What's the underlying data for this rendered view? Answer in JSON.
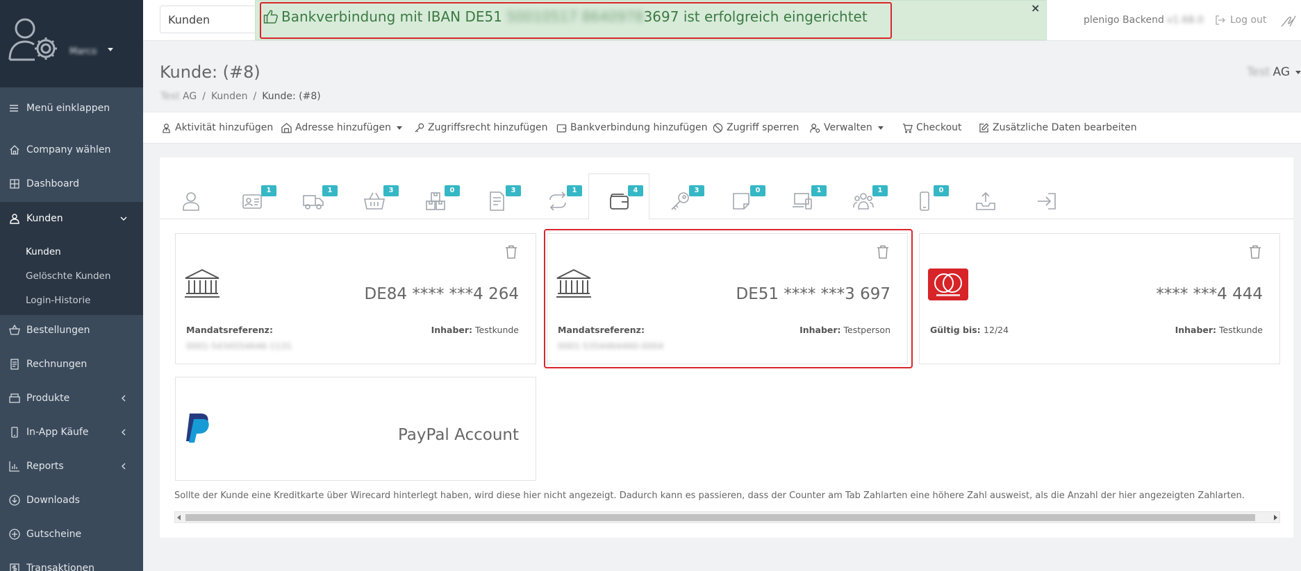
{
  "sidebar": {
    "username": "Marco",
    "items": [
      {
        "label": "Menü einklappen",
        "icon": "menu-icon"
      },
      {
        "label": "Company wählen",
        "icon": "home-icon"
      },
      {
        "label": "Dashboard",
        "icon": "grid-icon"
      },
      {
        "label": "Kunden",
        "icon": "user-icon"
      },
      {
        "label": "Bestellungen",
        "icon": "basket-icon"
      },
      {
        "label": "Rechnungen",
        "icon": "invoice-icon"
      },
      {
        "label": "Produkte",
        "icon": "box-icon"
      },
      {
        "label": "In-App Käufe",
        "icon": "phone-icon"
      },
      {
        "label": "Reports",
        "icon": "chart-icon"
      },
      {
        "label": "Downloads",
        "icon": "download-icon"
      },
      {
        "label": "Gutscheine",
        "icon": "voucher-icon"
      },
      {
        "label": "Transaktionen",
        "icon": "dollar-icon"
      }
    ],
    "subitems": [
      {
        "label": "Kunden"
      },
      {
        "label": "Gelöschte Kunden"
      },
      {
        "label": "Login-Historie"
      }
    ]
  },
  "header": {
    "select_value": "Kunden",
    "alert": {
      "prefix": "Bankverbindung mit IBAN DE51",
      "masked": "50010517 8640978",
      "suffix": "3697 ist erfolgreich eingerichtet",
      "close": "×"
    },
    "backend_label": "plenigo Backend",
    "backend_version": "v1.68.0",
    "logout_label": "Log out"
  },
  "page": {
    "title": "Kunde: (#8)",
    "breadcrumb": [
      {
        "blur": "Test",
        "label": "AG"
      },
      {
        "label": "Kunden"
      },
      {
        "label": "Kunde: (#8)"
      }
    ],
    "company_blur": "Test",
    "company_label": "AG"
  },
  "actions": [
    {
      "label": "Aktivität hinzufügen",
      "icon": "activity-icon"
    },
    {
      "label": "Adresse hinzufügen",
      "icon": "address-icon",
      "dropdown": true
    },
    {
      "label": "Zugriffsrecht hinzufügen",
      "icon": "key-icon"
    },
    {
      "label": "Bankverbindung hinzufügen",
      "icon": "wallet-icon"
    },
    {
      "label": "Zugriff sperren",
      "icon": "ban-icon"
    },
    {
      "label": "Verwalten",
      "icon": "manage-icon",
      "dropdown": true
    },
    {
      "label": "Checkout",
      "icon": "cart-icon"
    },
    {
      "label": "Zusätzliche Daten bearbeiten",
      "icon": "edit-icon"
    }
  ],
  "tabs": [
    {
      "icon": "user-tab-icon",
      "badge": ""
    },
    {
      "icon": "id-card-tab-icon",
      "badge": "1"
    },
    {
      "icon": "truck-tab-icon",
      "badge": "1"
    },
    {
      "icon": "basket-tab-icon",
      "badge": "3"
    },
    {
      "icon": "boxes-tab-icon",
      "badge": "0"
    },
    {
      "icon": "document-tab-icon",
      "badge": "3"
    },
    {
      "icon": "subscription-tab-icon",
      "badge": "1"
    },
    {
      "icon": "wallet-tab-icon",
      "badge": "4",
      "active": true
    },
    {
      "icon": "key-tab-icon",
      "badge": "3"
    },
    {
      "icon": "note-tab-icon",
      "badge": "0"
    },
    {
      "icon": "devices-tab-icon",
      "badge": "1"
    },
    {
      "icon": "group-tab-icon",
      "badge": "1"
    },
    {
      "icon": "mobile-tab-icon",
      "badge": "0"
    },
    {
      "icon": "upload-tab-icon",
      "badge": ""
    },
    {
      "icon": "login-tab-icon",
      "badge": ""
    }
  ],
  "payment_methods": [
    {
      "type": "bank",
      "number": "DE84 **** ***4 264",
      "mandate_label": "Mandatsreferenz:",
      "mandate_value": "0001-5434554646-1131",
      "holder_label": "Inhaber:",
      "holder": "Testkunde"
    },
    {
      "type": "bank",
      "number": "DE51 **** ***3 697",
      "mandate_label": "Mandatsreferenz:",
      "mandate_value": "0001-5354464460-0004",
      "holder_label": "Inhaber:",
      "holder": "Testperson",
      "highlighted": true
    },
    {
      "type": "creditcard",
      "number": "**** ***4 444",
      "valid_label": "Gültig bis:",
      "valid_value": "12/24",
      "holder_label": "Inhaber:",
      "holder": "Testkunde",
      "brand": "mastercard"
    },
    {
      "type": "paypal",
      "label": "PayPal Account"
    }
  ],
  "note": "Sollte der Kunde eine Kreditkarte über Wirecard hinterlegt haben, wird diese hier nicht angezeigt. Dadurch kann es passieren, dass der Counter am Tab Zahlarten eine höhere Zahl ausweist, als die Anzahl der hier angezeigten Zahlarten.",
  "colors": {
    "sidebar": "#3b4a5b",
    "sidebar_top": "#232f3c",
    "alert_bg": "#d8ebd9",
    "alert_text": "#3c7a43",
    "highlight": "#d9252c",
    "badge": "#35b7c6"
  }
}
